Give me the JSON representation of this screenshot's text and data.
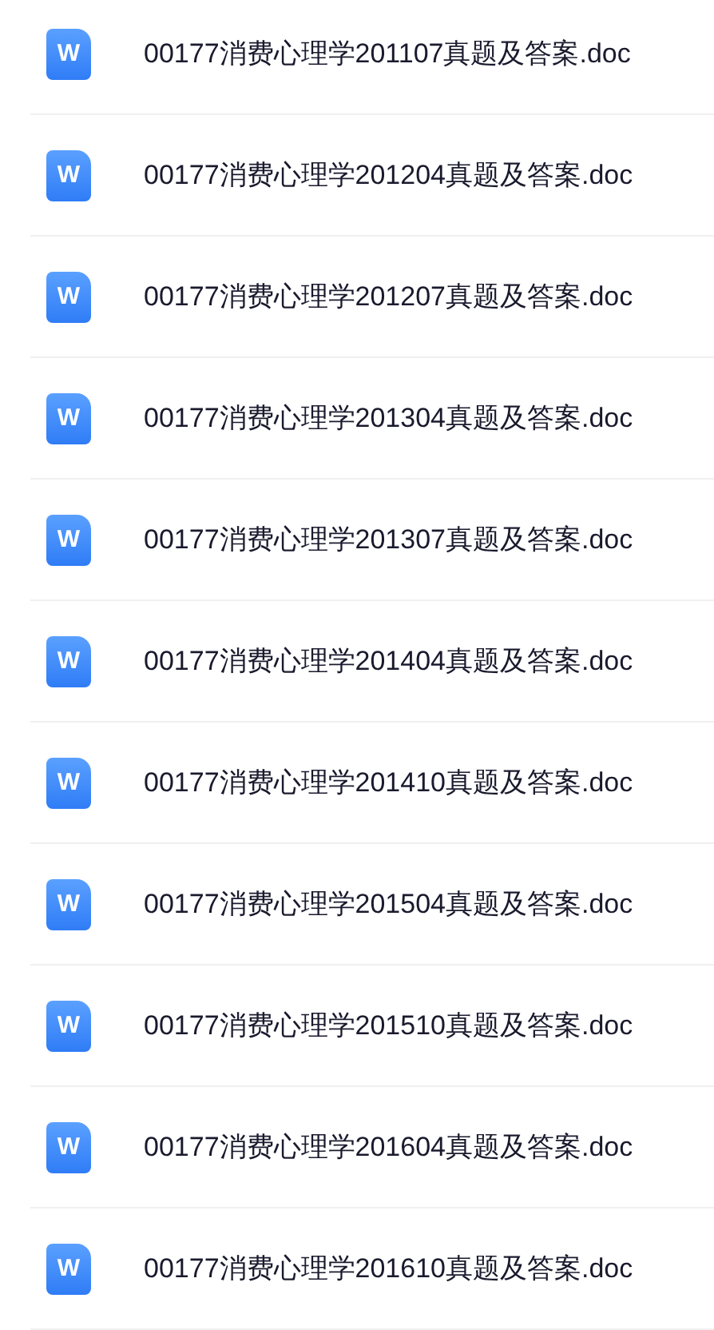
{
  "files": [
    {
      "name": "00177消费心理学201107真题及答案.doc",
      "icon_letter": "W"
    },
    {
      "name": "00177消费心理学201204真题及答案.doc",
      "icon_letter": "W"
    },
    {
      "name": "00177消费心理学201207真题及答案.doc",
      "icon_letter": "W"
    },
    {
      "name": "00177消费心理学201304真题及答案.doc",
      "icon_letter": "W"
    },
    {
      "name": "00177消费心理学201307真题及答案.doc",
      "icon_letter": "W"
    },
    {
      "name": "00177消费心理学201404真题及答案.doc",
      "icon_letter": "W"
    },
    {
      "name": "00177消费心理学201410真题及答案.doc",
      "icon_letter": "W"
    },
    {
      "name": "00177消费心理学201504真题及答案.doc",
      "icon_letter": "W"
    },
    {
      "name": "00177消费心理学201510真题及答案.doc",
      "icon_letter": "W"
    },
    {
      "name": "00177消费心理学201604真题及答案.doc",
      "icon_letter": "W"
    },
    {
      "name": "00177消费心理学201610真题及答案.doc",
      "icon_letter": "W"
    }
  ]
}
